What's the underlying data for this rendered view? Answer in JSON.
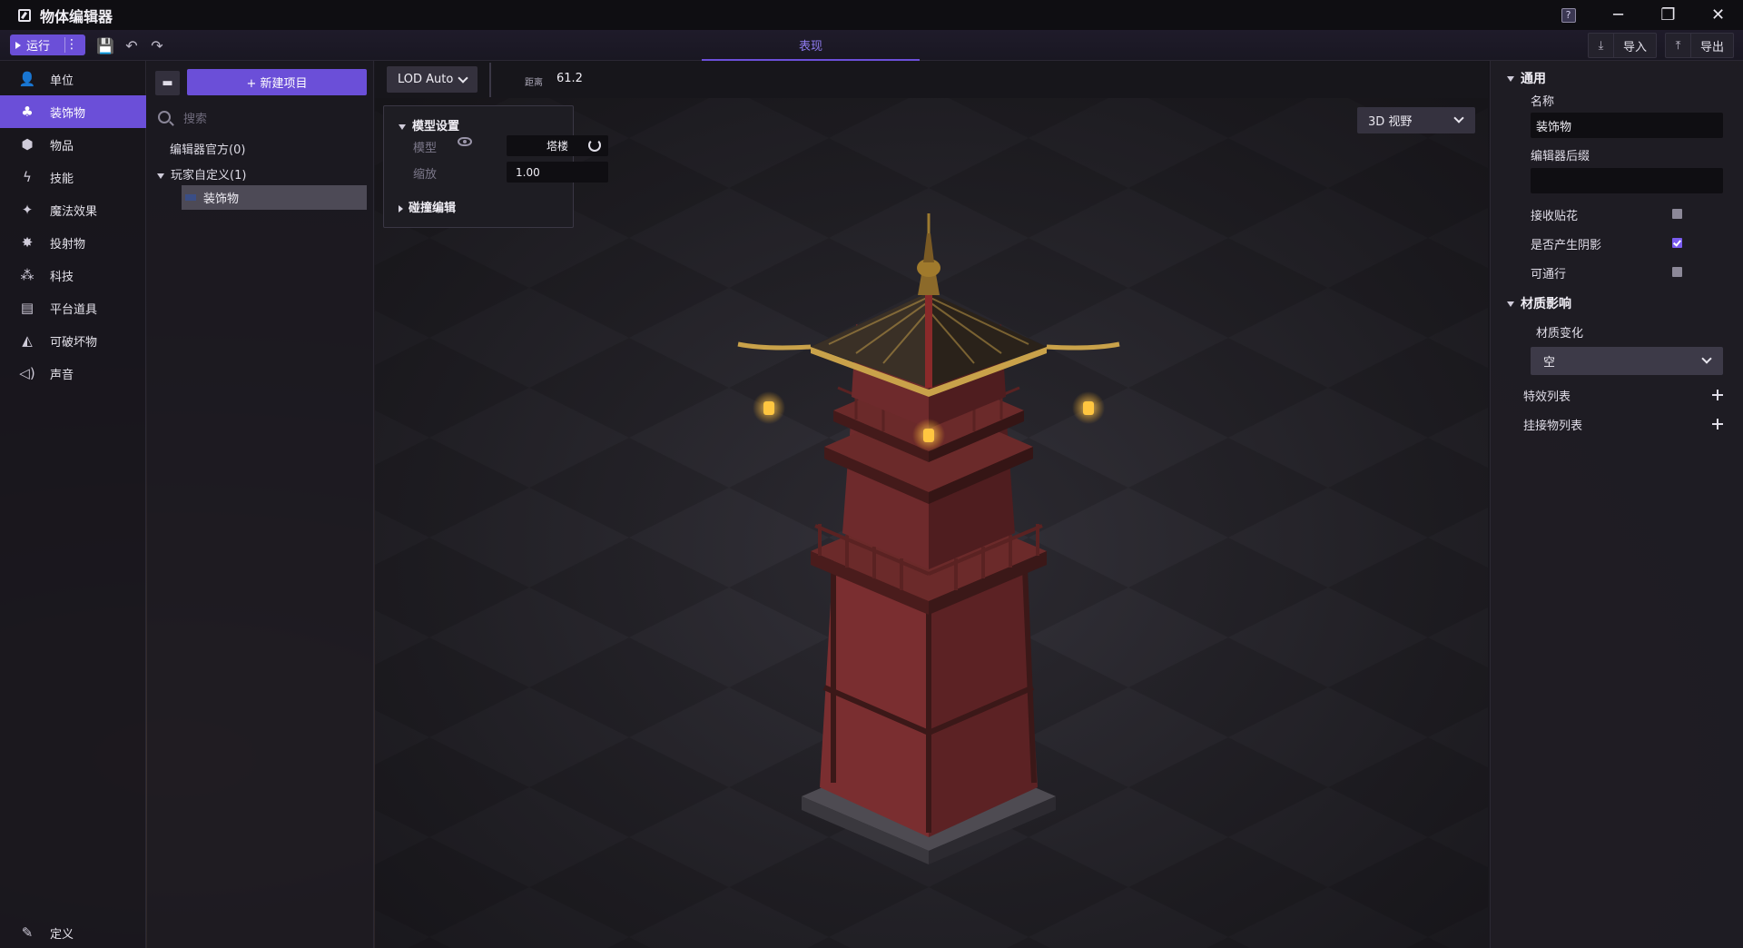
{
  "window": {
    "title": "物体编辑器",
    "help_glyph": "?",
    "minimize_glyph": "─",
    "restore_glyph": "❐",
    "close_glyph": "✕"
  },
  "toolbar": {
    "run_label": "运行",
    "more_glyph": "⋮",
    "save_glyph": "💾",
    "undo_glyph": "↶",
    "redo_glyph": "↷",
    "center_tab": "表现",
    "import_label": "导入",
    "export_label": "导出",
    "import_glyph": "⤓",
    "export_glyph": "⤒"
  },
  "categories": [
    {
      "label": "单位",
      "icon": "user-icon",
      "glyph": "👤"
    },
    {
      "label": "装饰物",
      "icon": "tree-icon",
      "glyph": "♣"
    },
    {
      "label": "物品",
      "icon": "cube-icon",
      "glyph": "⬢"
    },
    {
      "label": "技能",
      "icon": "lightning-icon",
      "glyph": "ϟ"
    },
    {
      "label": "魔法效果",
      "icon": "sparkle-icon",
      "glyph": "✦"
    },
    {
      "label": "投射物",
      "icon": "burst-icon",
      "glyph": "✸"
    },
    {
      "label": "科技",
      "icon": "molecule-icon",
      "glyph": "⁂"
    },
    {
      "label": "平台道具",
      "icon": "archive-icon",
      "glyph": "▤"
    },
    {
      "label": "可破坏物",
      "icon": "rubble-icon",
      "glyph": "◭"
    },
    {
      "label": "声音",
      "icon": "speaker-icon",
      "glyph": "◁)"
    }
  ],
  "active_category_index": 1,
  "bottom_item": {
    "label": "定义",
    "icon": "edit-icon",
    "glyph": "✎"
  },
  "tree": {
    "folder_glyph": "▬",
    "new_button_label": "+ 新建项目",
    "search_placeholder": "搜索",
    "official_node": "编辑器官方(0)",
    "custom_node": "玩家自定义(1)",
    "selected_item": "装饰物"
  },
  "viewport": {
    "lod_label": "LOD Auto",
    "distance_label": "距离",
    "distance_value": "61.2",
    "view_mode": "3D 视野",
    "model_panel": {
      "title": "模型设置",
      "model_label": "模型",
      "model_value": "塔楼",
      "scale_label": "缩放",
      "scale_value": "1.00",
      "collision_label": "碰撞编辑"
    }
  },
  "properties": {
    "general_title": "通用",
    "name_label": "名称",
    "name_value": "装饰物",
    "suffix_label": "编辑器后缀",
    "suffix_value": "",
    "checks": [
      {
        "label": "接收贴花",
        "checked": false
      },
      {
        "label": "是否产生阴影",
        "checked": true
      },
      {
        "label": "可通行",
        "checked": false
      }
    ],
    "material_title": "材质影响",
    "material_change_label": "材质变化",
    "material_change_value": "空",
    "effects_label": "特效列表",
    "attach_label": "挂接物列表"
  },
  "colors": {
    "accent": "#6b4fd8",
    "tower_red": "#7a2e30",
    "tower_dark": "#3b1818",
    "roof_gold": "#c9a24a",
    "lantern": "#ffc640"
  }
}
